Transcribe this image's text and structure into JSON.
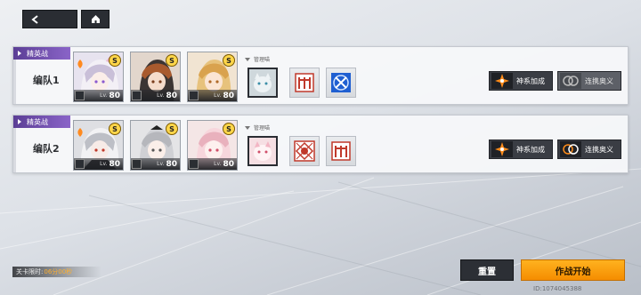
{
  "nav": {
    "back_icon": "back-arrow-icon",
    "home_icon": "home-icon"
  },
  "teams": [
    {
      "tag": "精英战",
      "name": "编队1",
      "manager_label": "管理喵",
      "characters": [
        {
          "level": "80",
          "lv_label": "Lv.",
          "rank": "S"
        },
        {
          "level": "80",
          "lv_label": "Lv.",
          "rank": "S"
        },
        {
          "level": "80",
          "lv_label": "Lv.",
          "rank": "S"
        }
      ],
      "skills": [
        "cat-manager-portrait",
        "trident-skill-icon",
        "cross-rune-skill-icon"
      ],
      "buttons": {
        "bonus": "神系加成",
        "combo": "连携奥义"
      }
    },
    {
      "tag": "精英战",
      "name": "编队2",
      "manager_label": "管理喵",
      "characters": [
        {
          "level": "80",
          "lv_label": "Lv.",
          "rank": "S"
        },
        {
          "level": "80",
          "lv_label": "Lv.",
          "rank": "S"
        },
        {
          "level": "80",
          "lv_label": "Lv.",
          "rank": "S"
        }
      ],
      "skills": [
        "cat-manager-portrait",
        "sigil-skill-icon",
        "trident-skill-icon"
      ],
      "buttons": {
        "bonus": "神系加成",
        "combo": "连携奥义"
      }
    }
  ],
  "footer": {
    "time_label": "关卡限时:",
    "time_value": "06分00秒",
    "reset": "重置",
    "start": "作战开始",
    "uid": "ID:1074045388"
  },
  "colors": {
    "accent": "#f5a000",
    "tag": "#6a4aa8",
    "dark": "#2c2f35"
  }
}
